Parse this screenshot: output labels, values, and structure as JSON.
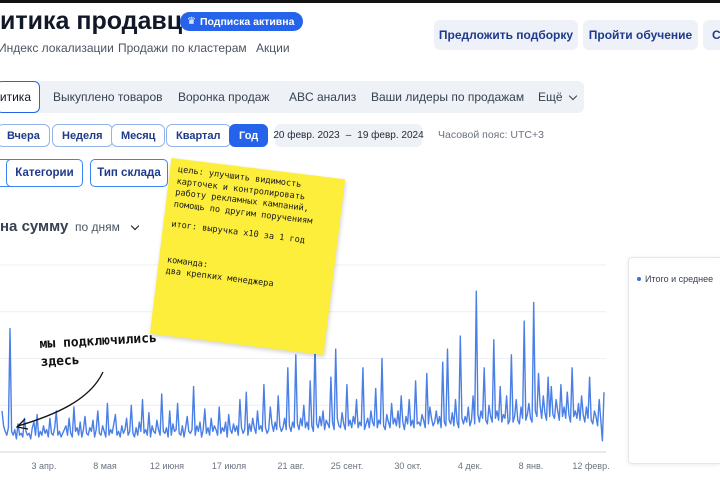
{
  "header": {
    "title": "итика продавца",
    "badge": "Подписка активна",
    "links": [
      "Индекс локализации",
      "Продажи по кластерам",
      "Акции"
    ],
    "buttons": [
      "Предложить подборку",
      "Пройти обучение",
      "С"
    ]
  },
  "tabs": {
    "items": [
      "итика",
      "Выкуплено товаров",
      "Воронка продаж",
      "ABC анализ",
      "Ваши лидеры по продажам"
    ],
    "more": "Ещё"
  },
  "period": {
    "options": [
      "Вчера",
      "Неделя",
      "Месяц",
      "Квартал",
      "Год"
    ],
    "selected": "Год",
    "date_from": "20 февр. 2023",
    "date_sep": "–",
    "date_to": "19 февр. 2024",
    "timezone": "Часовой пояс: UTC+3"
  },
  "filters": [
    "",
    "Категории",
    "Тип склада"
  ],
  "section": {
    "title": "на сумму",
    "group_by": "по дням"
  },
  "legend": {
    "label": "Итого и среднее"
  },
  "sticky_note": {
    "goal": "цель: улучшить видимость карточек и контролировать работу рекламных кампаний, помощь по другим поручениям",
    "result": "итог: выручка х10 за 1 год",
    "team_1": "команда:",
    "team_2": "два крепких менеджера"
  },
  "annotation": {
    "line1": "мы подключились",
    "line2": "здесь"
  },
  "chart_data": {
    "type": "line",
    "x_ticks": [
      "3 апр.",
      "8 мая",
      "12 июня",
      "17 июля",
      "21 авг.",
      "25 сент.",
      "30 окт.",
      "4 дек.",
      "8 янв.",
      "12 февр."
    ],
    "x_range": [
      "20 февр. 2023",
      "19 февр. 2024"
    ],
    "ylim": [
      0,
      100
    ],
    "grid": true,
    "color": "#4a7fe6",
    "values": [
      22,
      14,
      11,
      9,
      13,
      66,
      11,
      9,
      12,
      7,
      15,
      9,
      10,
      8,
      18,
      11,
      9,
      10,
      7,
      13,
      16,
      9,
      20,
      8,
      11,
      9,
      14,
      10,
      12,
      8,
      18,
      10,
      9,
      13,
      22,
      9,
      11,
      8,
      10,
      12,
      14,
      9,
      18,
      10,
      8,
      24,
      11,
      13,
      9,
      16,
      8,
      12,
      19,
      10,
      9,
      13,
      11,
      17,
      8,
      12,
      22,
      10,
      9,
      14,
      11,
      8,
      26,
      9,
      12,
      10,
      15,
      20,
      9,
      11,
      8,
      14,
      10,
      12,
      18,
      9,
      11,
      25,
      10,
      8,
      13,
      9,
      16,
      11,
      28,
      10,
      12,
      9,
      21,
      8,
      14,
      11,
      10,
      17,
      12,
      9,
      31,
      11,
      10,
      13,
      8,
      22,
      9,
      15,
      11,
      12,
      26,
      10,
      9,
      14,
      8,
      13,
      19,
      11,
      10,
      12,
      35,
      9,
      14,
      11,
      16,
      8,
      12,
      23,
      10,
      13,
      9,
      18,
      11,
      14,
      12,
      9,
      24,
      10,
      13,
      11,
      16,
      8,
      20,
      12,
      10,
      15,
      11,
      14,
      9,
      28,
      13,
      10,
      12,
      32,
      9,
      15,
      11,
      18,
      13,
      10,
      22,
      12,
      14,
      11,
      36,
      13,
      10,
      12,
      24,
      15,
      11,
      16,
      12,
      30,
      14,
      11,
      13,
      18,
      12,
      45,
      14,
      11,
      16,
      13,
      52,
      15,
      12,
      18,
      14,
      25,
      13,
      16,
      12,
      38,
      14,
      11,
      60,
      15,
      13,
      19,
      14,
      22,
      12,
      17,
      15,
      13,
      40,
      16,
      12,
      55,
      18,
      14,
      13,
      21,
      15,
      12,
      36,
      14,
      17,
      13,
      19,
      15,
      28,
      13,
      16,
      14,
      45,
      12,
      15,
      18,
      13,
      22,
      16,
      14,
      34,
      13,
      17,
      15,
      50,
      14,
      12,
      20,
      16,
      13,
      26,
      15,
      18,
      14,
      22,
      13,
      30,
      16,
      12,
      19,
      15,
      28,
      14,
      17,
      13,
      38,
      15,
      16,
      14,
      20,
      17,
      13,
      42,
      15,
      24,
      18,
      14,
      16,
      22,
      15,
      19,
      13,
      48,
      16,
      14,
      55,
      17,
      15,
      21,
      14,
      28,
      16,
      13,
      62,
      18,
      15,
      19,
      16,
      24,
      14,
      17,
      30,
      15,
      86,
      20,
      16,
      22,
      18,
      45,
      17,
      15,
      25,
      19,
      16,
      60,
      18,
      22,
      17,
      35,
      16,
      20,
      18,
      30,
      15,
      17,
      52,
      16,
      19,
      28,
      17,
      15,
      24,
      18,
      70,
      17,
      20,
      26,
      18,
      16,
      80,
      22,
      19,
      42,
      25,
      18,
      30,
      21,
      17,
      40,
      19,
      35,
      20,
      18,
      28,
      22,
      17,
      36,
      19,
      24,
      18,
      32,
      20,
      16,
      45,
      19,
      22,
      18,
      26,
      17,
      30,
      20,
      16,
      24,
      18,
      40,
      17,
      15,
      22,
      19,
      14,
      28,
      17,
      6,
      32
    ]
  }
}
